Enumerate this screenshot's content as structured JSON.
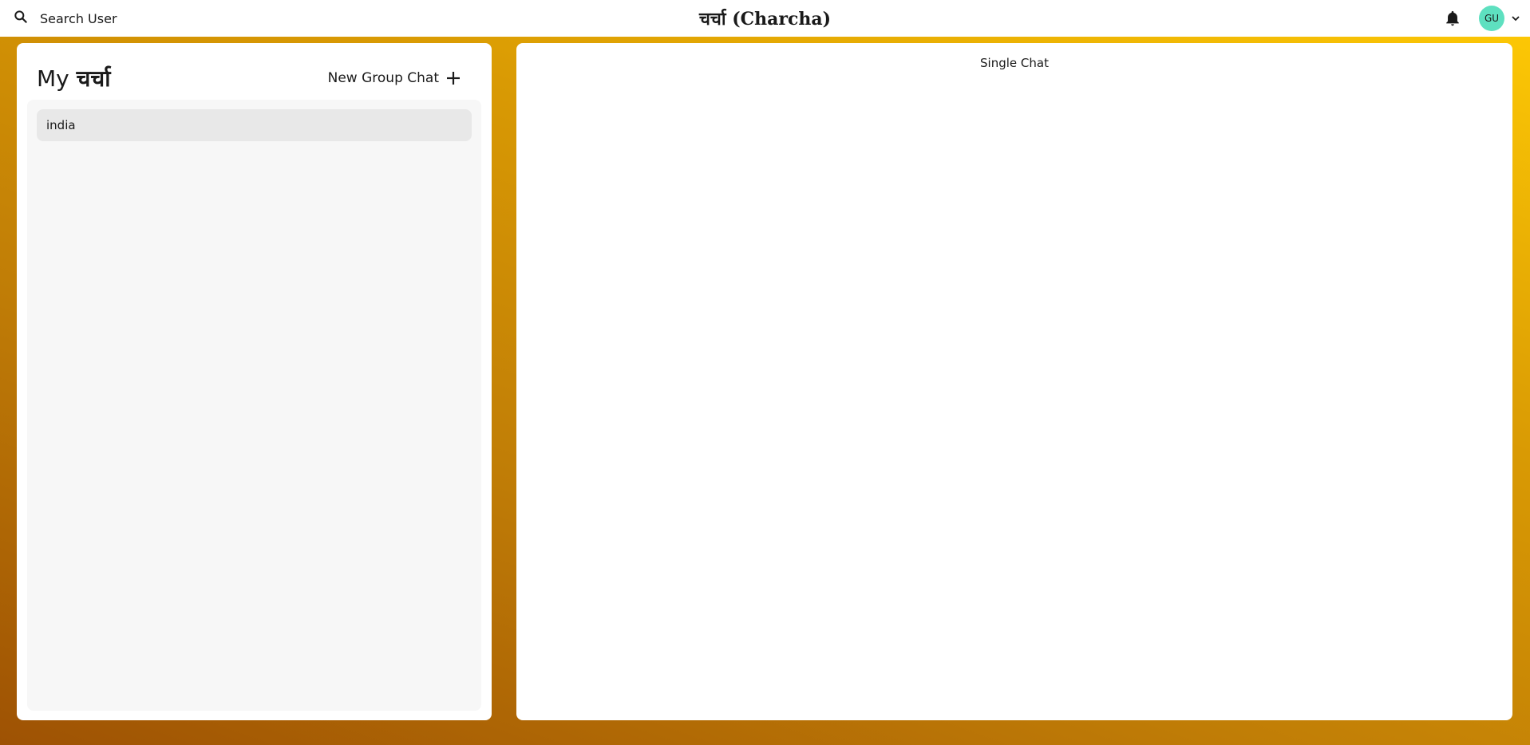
{
  "topbar": {
    "search_label": "Search User",
    "app_title": "चर्चा (Charcha)",
    "avatar_initials": "GU"
  },
  "chats_panel": {
    "title_prefix": "My",
    "title_hindi": "चर्चा",
    "new_group_label": "New Group Chat",
    "chats": [
      {
        "name": "india"
      }
    ]
  },
  "chat_panel": {
    "placeholder_label": "Single Chat"
  },
  "colors": {
    "avatar_bg": "#5ee0c0",
    "gradient_start": "#9e5204",
    "gradient_end": "#ffcb05",
    "selected_chat_bg": "#e8e8e8",
    "list_bg": "#f7f7f7"
  },
  "icons": {
    "search": "search-icon",
    "notification": "bell-icon",
    "menu": "chevron-down-icon",
    "add": "plus-icon"
  }
}
